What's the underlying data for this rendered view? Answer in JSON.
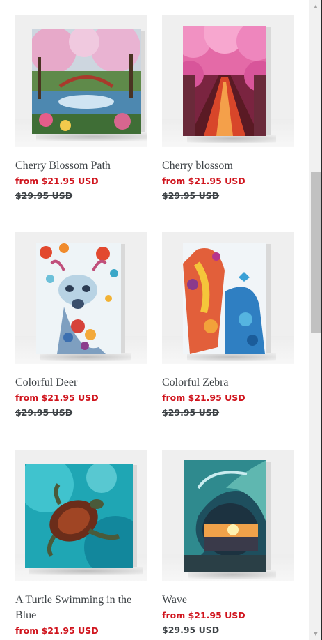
{
  "products": [
    {
      "title": "Cherry Blossom Path",
      "price": "from $21.95 USD",
      "compare_price": "$29.95 USD",
      "image_icon": "painting-cherry-blossom-path"
    },
    {
      "title": "Cherry blossom",
      "price": "from $21.95 USD",
      "compare_price": "$29.95 USD",
      "image_icon": "painting-cherry-blossom-canal"
    },
    {
      "title": "Colorful Deer",
      "price": "from $21.95 USD",
      "compare_price": "$29.95 USD",
      "image_icon": "painting-colorful-deer"
    },
    {
      "title": "Colorful Zebra",
      "price": "from $21.95 USD",
      "compare_price": "$29.95 USD",
      "image_icon": "painting-colorful-giraffes"
    },
    {
      "title": "A Turtle Swimming in the Blue",
      "price": "from $21.95 USD",
      "compare_price": "",
      "image_icon": "painting-sea-turtle"
    },
    {
      "title": "Wave",
      "price": "from $21.95 USD",
      "compare_price": "$29.95 USD",
      "image_icon": "painting-ocean-wave-sunset"
    }
  ],
  "colors": {
    "sale_price": "#d0141d",
    "text": "#3d4246",
    "thumb_bg": "#efefef"
  },
  "scrollbar": {
    "up_icon": "triangle-up-icon",
    "down_icon": "triangle-down-icon"
  }
}
